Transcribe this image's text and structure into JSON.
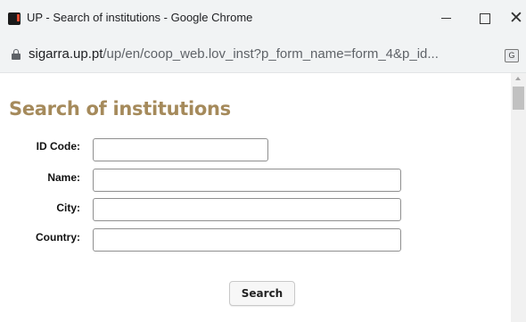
{
  "window": {
    "title": "UP - Search of institutions - Google Chrome",
    "controls": {
      "minimize": "—",
      "maximize": "☐",
      "close": "✕"
    }
  },
  "addressbar": {
    "url_host": "sigarra.up.pt",
    "url_rest": "/up/en/coop_web.lov_inst?p_form_name=form_4&p_id..."
  },
  "page": {
    "title": "Search of institutions",
    "form": {
      "id_code_label": "ID Code:",
      "id_code_value": "",
      "name_label": "Name:",
      "name_value": "",
      "city_label": "City:",
      "city_value": "",
      "country_label": "Country:",
      "country_value": "",
      "search_label": "Search"
    }
  },
  "icons": {
    "app": "up-logo-icon",
    "lock": "lock-icon",
    "translate": "translate-icon"
  },
  "colors": {
    "title_accent": "#a58a5b",
    "chrome_bg": "#f1f3f4"
  }
}
